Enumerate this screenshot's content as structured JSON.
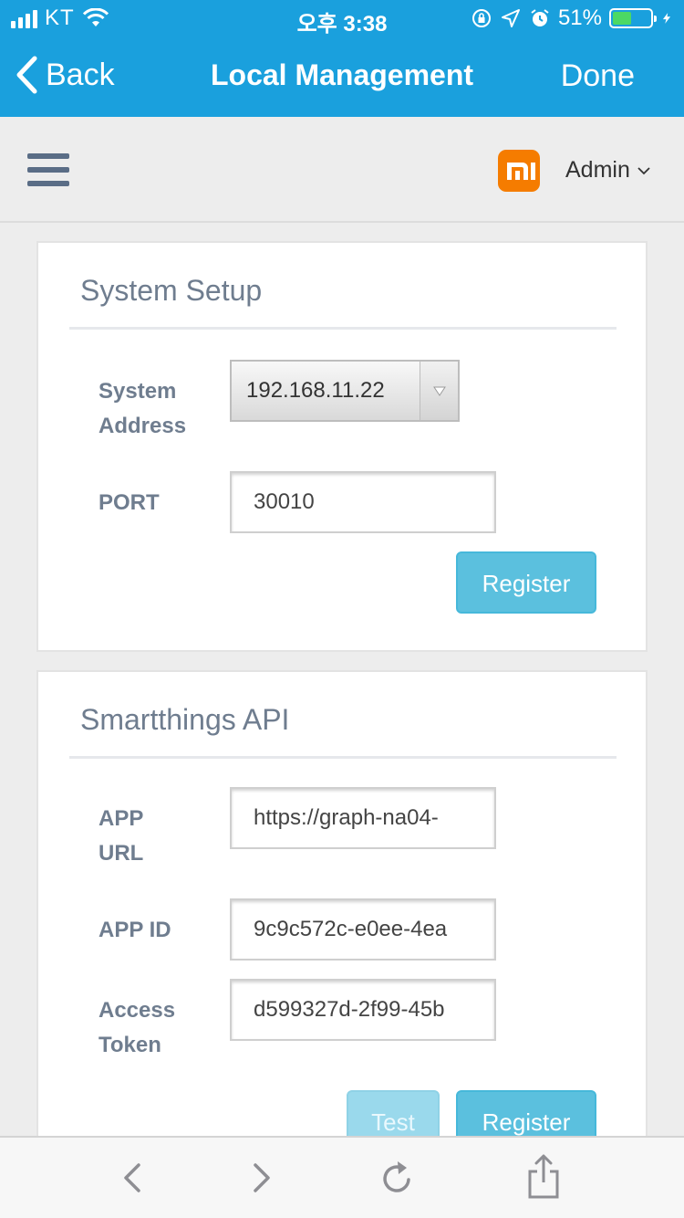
{
  "status_bar": {
    "carrier": "KT",
    "time": "오후 3:38",
    "battery": "51%",
    "battery_level": 0.51
  },
  "nav": {
    "back_label": "Back",
    "title": "Local Management",
    "done_label": "Done"
  },
  "header": {
    "user_label": "Admin",
    "logo_icon": "mi-logo-icon",
    "brand_color": "#f57c00",
    "accent_color": "#1aa0dd"
  },
  "system_setup": {
    "title": "System Setup",
    "address_label_line1": "System",
    "address_label_line2": "Address",
    "address_value": "192.168.11.22",
    "port_label": "PORT",
    "port_value": "30010",
    "register_label": "Register"
  },
  "smartthings": {
    "title": "Smartthings API",
    "app_url_label_line1": "APP",
    "app_url_label_line2": "URL",
    "app_url_value": "https://graph-na04-",
    "app_id_label": "APP ID",
    "app_id_value": "9c9c572c-e0ee-4ea",
    "token_label_line1": "Access",
    "token_label_line2": "Token",
    "token_value": "d599327d-2f99-45b",
    "test_label": "Test",
    "register_label": "Register"
  },
  "toolbar": {
    "icons": [
      "back-arrow-icon",
      "forward-arrow-icon",
      "reload-icon",
      "share-icon"
    ]
  }
}
